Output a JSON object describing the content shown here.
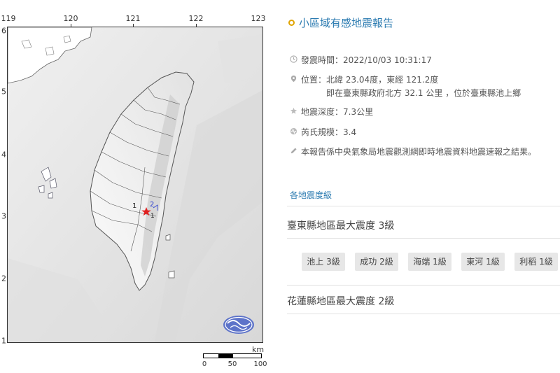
{
  "map": {
    "longitudes": [
      "119",
      "120",
      "121",
      "122",
      "123"
    ],
    "latitudes": [
      "6",
      "5",
      "4",
      "3",
      "2",
      "1"
    ],
    "intensity_marks": [
      {
        "label": "1"
      },
      {
        "label": "2"
      },
      {
        "label": "1"
      }
    ],
    "epicenter_color": "#e02020",
    "logo_name": "central-weather-bureau-logo",
    "scale": {
      "unit": "km",
      "ticks": [
        "0",
        "50",
        "100"
      ]
    }
  },
  "report": {
    "title": "小區域有感地震報告",
    "time": "發震時間：2022/10/03 10:31:17",
    "location": "位置：北緯 23.04度，東經 121.2度",
    "location_detail": "即在臺東縣政府北方 32.1 公里 ，位於臺東縣池上鄉",
    "depth": "地震深度：7.3公里",
    "magnitude": "芮氏規模：3.4",
    "note": "本報告係中央氣象局地震觀測網即時地震資料地震速報之結果。",
    "intensity_section": "各地震度級",
    "regions": [
      {
        "heading": "臺東縣地區最大震度 3級",
        "stations": [
          "池上 3級",
          "成功 2級",
          "海端 1級",
          "東河 1級",
          "利稻 1級"
        ]
      },
      {
        "heading": "花蓮縣地區最大震度 2級",
        "stations": []
      }
    ]
  }
}
